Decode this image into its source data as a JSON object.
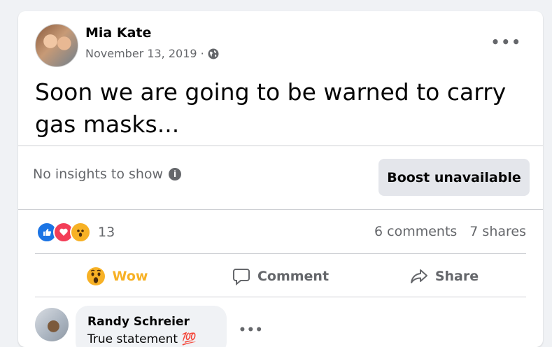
{
  "post": {
    "author": "Mia Kate",
    "date": "November 13, 2019 ·",
    "privacy_icon": "globe-icon",
    "text": "Soon we are going to be warned to carry gas masks..."
  },
  "insights": {
    "label": "No insights to show",
    "boost_label": "Boost unavailable"
  },
  "reactions": {
    "icons": [
      "like-icon",
      "love-icon",
      "wow-icon"
    ],
    "count": "13",
    "comments": "6 comments",
    "shares": "7 shares"
  },
  "actions": {
    "wow": "Wow",
    "comment": "Comment",
    "share": "Share"
  },
  "comment": {
    "author": "Randy Schreier",
    "text": "True statement 💯"
  },
  "colors": {
    "accent_wow": "#f7b125",
    "like": "#1b74e4",
    "love": "#f33e58",
    "secondary_text": "#65676b"
  }
}
